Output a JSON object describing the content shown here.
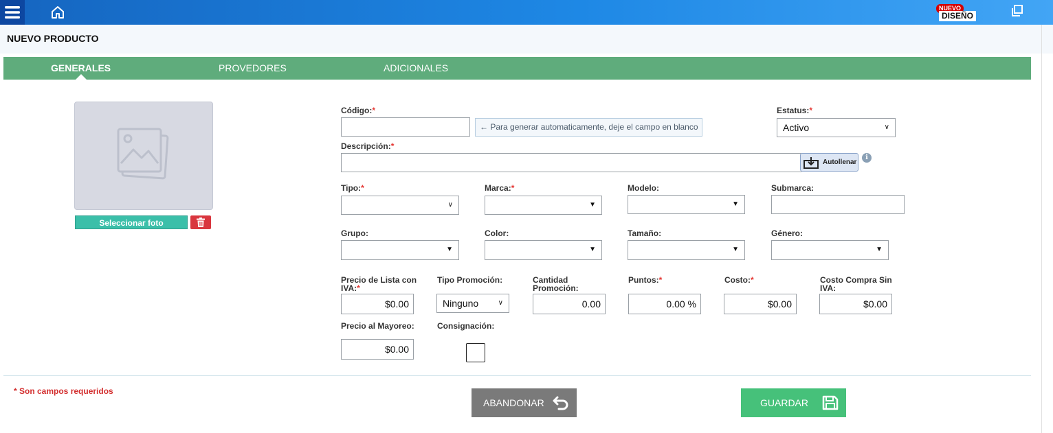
{
  "topbar": {
    "design_badge_new": "NUEVO",
    "design_badge_label": "DISEÑO"
  },
  "page": {
    "title": "NUEVO PRODUCTO"
  },
  "tabs": [
    {
      "label": "GENERALES",
      "active": true
    },
    {
      "label": "PROVEDORES",
      "active": false
    },
    {
      "label": "ADICIONALES",
      "active": false
    }
  ],
  "photo": {
    "select_label": "Seleccionar foto"
  },
  "form": {
    "codigo": {
      "label": "Código:",
      "required": "*",
      "value": ""
    },
    "codigo_hint": "← Para generar automaticamente, deje el campo en blanco",
    "estatus": {
      "label": "Estatus:",
      "required": "*",
      "value": "Activo"
    },
    "descripcion": {
      "label": "Descripción:",
      "required": "*",
      "value": ""
    },
    "autofill_label": "Autollenar",
    "tipo": {
      "label": "Tipo:",
      "required": "*",
      "value": ""
    },
    "marca": {
      "label": "Marca:",
      "required": "*",
      "value": ""
    },
    "modelo": {
      "label": "Modelo:",
      "value": ""
    },
    "submarca": {
      "label": "Submarca:",
      "value": ""
    },
    "grupo": {
      "label": "Grupo:",
      "value": ""
    },
    "color": {
      "label": "Color:",
      "value": ""
    },
    "tamano": {
      "label": "Tamaño:",
      "value": ""
    },
    "genero": {
      "label": "Género:",
      "value": ""
    },
    "precio_lista": {
      "label": "Precio de Lista con IVA:",
      "required": "*",
      "value": "$0.00"
    },
    "tipo_promocion": {
      "label": "Tipo Promoción:",
      "value": "Ninguno"
    },
    "cantidad_promocion": {
      "label": "Cantidad Promoción:",
      "value": "0.00"
    },
    "puntos": {
      "label": "Puntos:",
      "required": "*",
      "value": "0.00 %"
    },
    "costo": {
      "label": "Costo:",
      "required": "*",
      "value": "$0.00"
    },
    "costo_compra": {
      "label": "Costo Compra Sin IVA:",
      "value": "$0.00"
    },
    "precio_mayoreo": {
      "label": "Precio al Mayoreo:",
      "value": "$0.00"
    },
    "consignacion": {
      "label": "Consignación:",
      "checked": false
    }
  },
  "footer": {
    "required_note": "* Son campos requeridos",
    "abandon_label": "ABANDONAR",
    "save_label": "GUARDAR"
  },
  "colors": {
    "topbar": "#1e88e5",
    "tabbar": "#5fac7c",
    "save": "#46c17a",
    "abandon": "#7a7a7a",
    "required": "#e53935"
  }
}
